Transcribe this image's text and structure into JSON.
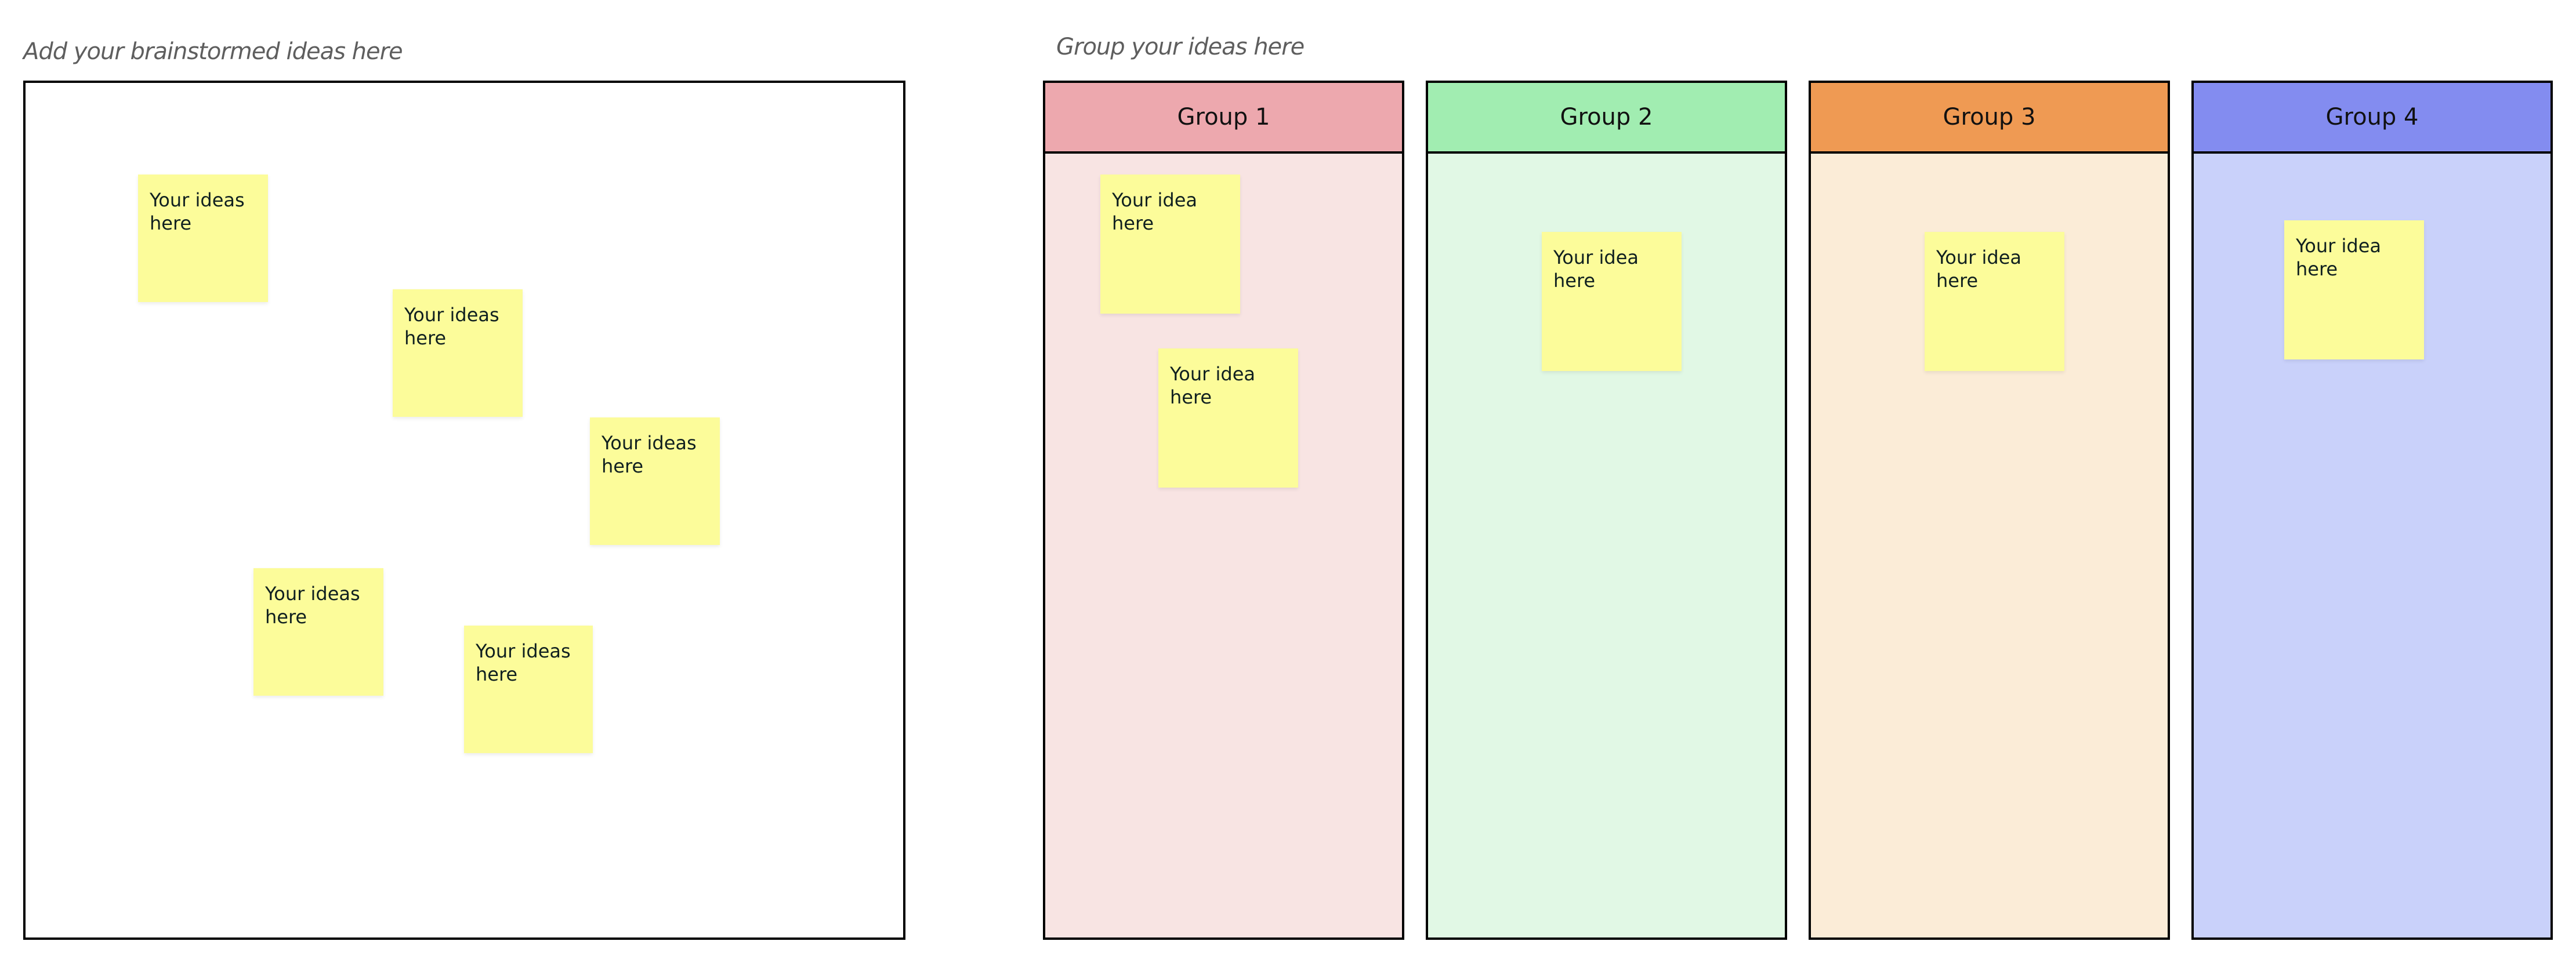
{
  "brainstorm": {
    "title": "Add your brainstormed ideas here",
    "notes": [
      {
        "text": "Your ideas here"
      },
      {
        "text": "Your ideas here"
      },
      {
        "text": "Your ideas here"
      },
      {
        "text": "Your ideas here"
      },
      {
        "text": "Your ideas here"
      }
    ]
  },
  "grouping": {
    "title": "Group your ideas here",
    "groups": [
      {
        "label": "Group 1",
        "header_color": "#eda8ae",
        "body_color": "#f8e4e3",
        "notes": [
          {
            "text": "Your idea here"
          },
          {
            "text": "Your idea here"
          }
        ]
      },
      {
        "label": "Group 2",
        "header_color": "#a1edb1",
        "body_color": "#e1f8e5",
        "notes": [
          {
            "text": "Your idea here"
          }
        ]
      },
      {
        "label": "Group 3",
        "header_color": "#ef9a53",
        "body_color": "#fbecd7",
        "notes": [
          {
            "text": "Your idea here"
          }
        ]
      },
      {
        "label": "Group 4",
        "header_color": "#838cf0",
        "body_color": "#c9d1fa",
        "notes": [
          {
            "text": "Your idea here"
          }
        ]
      }
    ]
  },
  "colors": {
    "sticky_note": "#fcfc9a",
    "border": "#000000"
  }
}
